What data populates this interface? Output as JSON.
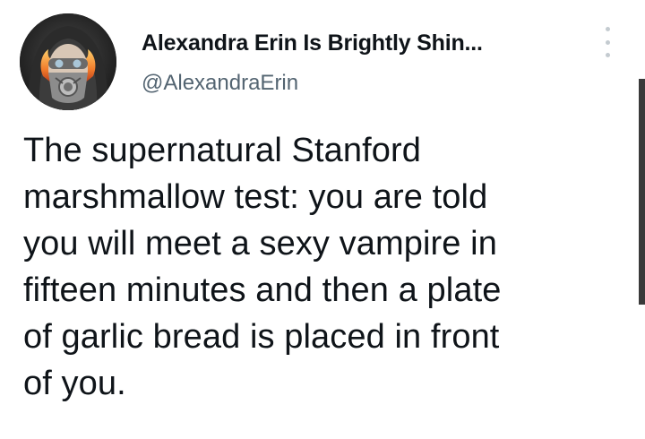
{
  "author": {
    "display_name": "Alexandra Erin Is Brightly Shin...",
    "handle": "@AlexandraErin",
    "avatar_icon": "hooded-masked-figure-avatar"
  },
  "tweet": {
    "text": "The supernatural Stanford\nmarshmallow test: you are told\nyou will meet a sexy vampire in\nfifteen minutes and then a plate\nof garlic bread is placed in front\nof you."
  },
  "controls": {
    "more_icon": "vertical-ellipsis-icon"
  },
  "colors": {
    "text_primary": "#0f1419",
    "text_secondary": "#536471",
    "background": "#ffffff"
  }
}
